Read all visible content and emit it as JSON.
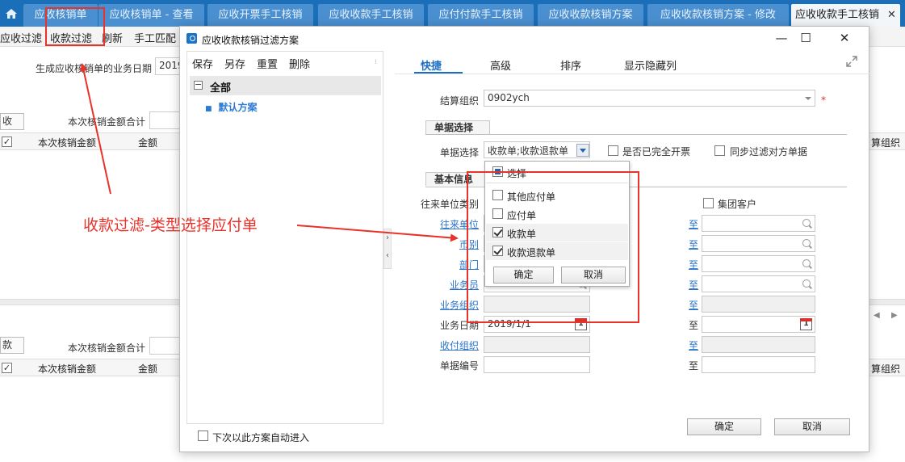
{
  "tabs": [
    {
      "label": "应收核销单"
    },
    {
      "label": "应收核销单 - 查看"
    },
    {
      "label": "应收开票手工核销"
    },
    {
      "label": "应收收款手工核销"
    },
    {
      "label": "应付付款手工核销"
    },
    {
      "label": "应收收款核销方案"
    },
    {
      "label": "应收收款核销方案 - 修改"
    },
    {
      "label": "应收收款手工核销"
    }
  ],
  "toolbar": {
    "items": [
      "应收过滤",
      "收款过滤",
      "刷新",
      "手工匹配"
    ]
  },
  "background": {
    "biz_date_label": "生成应收核销单的业务日期",
    "biz_date_value": "2019",
    "sum_label_top": "本次核销金额合计",
    "sum_label_bottom": "本次核销金额合计",
    "section_top_tab": "收",
    "section_bottom_tab": "款",
    "grid_headers": [
      "本次核销金额",
      "金额"
    ],
    "right_col_header": "算组织"
  },
  "dialog": {
    "title": "应收收款核销过滤方案",
    "left_menu": [
      "保存",
      "另存",
      "重置",
      "删除"
    ],
    "tree_all": "全部",
    "tree_default": "默认方案",
    "auto_enter_label": "下次以此方案自动进入",
    "tabs": [
      "快捷",
      "高级",
      "排序",
      "显示隐藏列"
    ],
    "settle_org_label": "结算组织",
    "settle_org_value": "0902ych",
    "required_mark": "*",
    "section_doc_select": "单据选择",
    "doc_select_label": "单据选择",
    "doc_select_value": "收款单;收款退款单",
    "fully_invoiced_label": "是否已完全开票",
    "sync_filter_label": "同步过滤对方单据",
    "section_basic_info": "基本信息",
    "partner_type_label": "往来单位类别",
    "group_customer_label": "集团客户",
    "fields": [
      "往来单位",
      "币别",
      "部门",
      "业务员",
      "业务组织",
      "业务日期",
      "收付组织",
      "单据编号"
    ],
    "biz_date_from": "2019/1/1",
    "to_label": "至",
    "ok_button": "确定",
    "cancel_button": "取消"
  },
  "dropdown": {
    "select_all": "选择",
    "options": [
      {
        "label": "其他应付单",
        "checked": false
      },
      {
        "label": "应付单",
        "checked": false
      },
      {
        "label": "收款单",
        "checked": true
      },
      {
        "label": "收款退款单",
        "checked": true
      }
    ],
    "ok_button": "确定",
    "cancel_button": "取消"
  },
  "annotation": {
    "text": "收款过滤-类型选择应付单",
    "color": "#e8322a"
  },
  "colors": {
    "tabbar": "#1a6fb8",
    "link": "#2a73c7",
    "accent": "#1b6ec2"
  }
}
